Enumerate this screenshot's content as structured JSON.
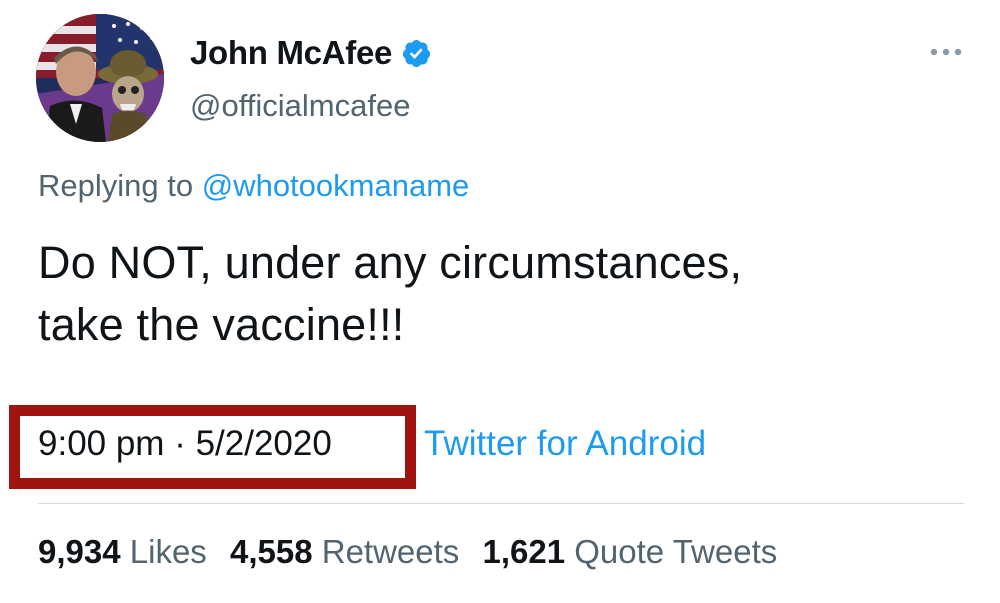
{
  "author": {
    "display_name": "John McAfee",
    "handle": "@officialmcafee",
    "verified": true,
    "avatar_icon": "profile-photo"
  },
  "reply": {
    "prefix": "Replying to",
    "to": "@whotookmaname"
  },
  "tweet": {
    "lines": [
      "Do NOT, under any circumstances,",
      "take the vaccine!!!"
    ]
  },
  "meta": {
    "time_date": "9:00 pm · 5/2/2020",
    "source": "Twitter for Android"
  },
  "stats": [
    {
      "count": "9,934",
      "label": "Likes"
    },
    {
      "count": "4,558",
      "label": "Retweets"
    },
    {
      "count": "1,621",
      "label": "Quote Tweets"
    }
  ],
  "colors": {
    "link": "#1d9bf0",
    "secondary_text": "#536471",
    "highlight_border": "#a0140f",
    "verified_badge": "#1d9bf0"
  }
}
